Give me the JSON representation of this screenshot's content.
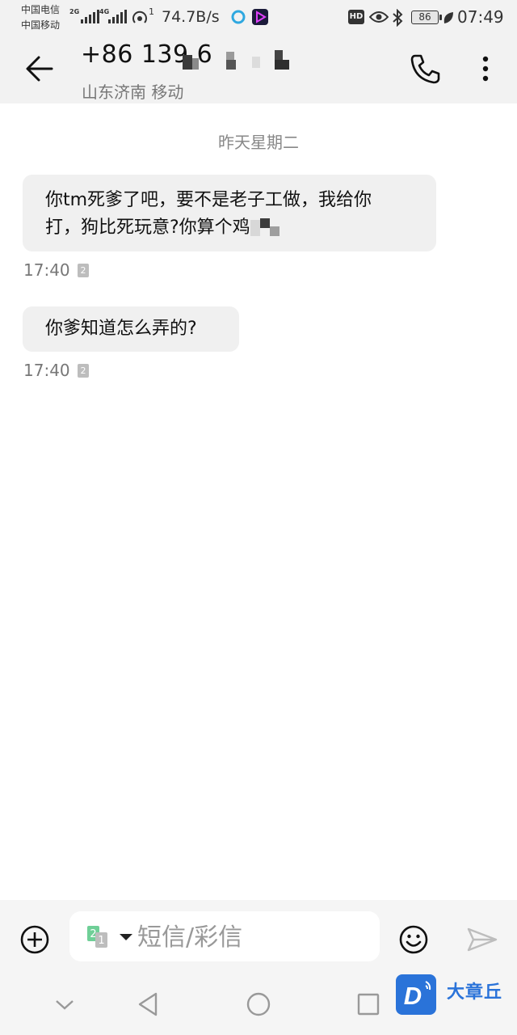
{
  "status_bar": {
    "carrier1": "中国电信",
    "carrier2": "中国移动",
    "net1": "2G",
    "net2": "4G",
    "hotspot_count": "1",
    "speed": "74.7B/s",
    "hd_label": "HD",
    "battery": "86",
    "time": "07:49",
    "icons": [
      "signal-icon",
      "hotspot-icon",
      "app-icon-blue",
      "app-icon-purple",
      "eye-icon",
      "bluetooth-icon",
      "battery-icon",
      "leaf-icon"
    ]
  },
  "header": {
    "contact_name": "+86 139 6",
    "contact_location": "山东济南 移动",
    "icons": [
      "back-arrow-icon",
      "phone-icon",
      "more-vertical-icon"
    ]
  },
  "conversation": {
    "date_separator": "昨天星期二",
    "messages": [
      {
        "line1": "你tm死爹了吧，要不是老子工做，我给你",
        "line2": "打，狗比死玩意?你算个鸡",
        "time": "17:40",
        "sim": "2"
      },
      {
        "line1": "你爹知道怎么弄的?",
        "time": "17:40",
        "sim": "2"
      }
    ]
  },
  "composer": {
    "placeholder": "短信/彩信",
    "sim_primary": "2",
    "sim_secondary": "1",
    "icons": [
      "add-circle-icon",
      "sim-select-icon",
      "emoji-icon",
      "send-icon"
    ]
  },
  "watermark": {
    "text": "大章丘",
    "logo_letter": "D"
  },
  "colors": {
    "bar_bg": "#f2f2f2",
    "bubble_bg": "#f0f0f0",
    "accent_blue": "#2a73d9",
    "sim_green": "#6fcf97"
  }
}
